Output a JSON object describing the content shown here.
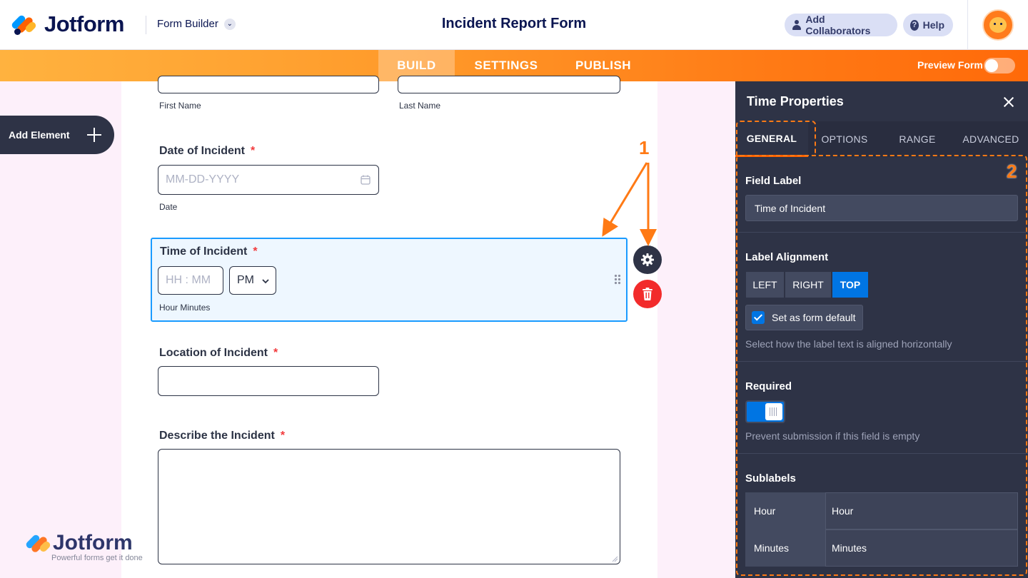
{
  "header": {
    "brand": "Jotform",
    "builder_label": "Form Builder",
    "form_title": "Incident Report Form",
    "collaborators_label": "Add Collaborators",
    "help_label": "Help"
  },
  "nav": {
    "tabs": [
      "BUILD",
      "SETTINGS",
      "PUBLISH"
    ],
    "active": "BUILD",
    "preview_label": "Preview Form"
  },
  "sidebar": {
    "add_element_label": "Add Element"
  },
  "form": {
    "name_sublabels": [
      "First Name",
      "Last Name"
    ],
    "fields": [
      {
        "label": "Date of Incident",
        "required": "*",
        "placeholder": "MM-DD-YYYY",
        "sublabel": "Date"
      },
      {
        "label": "Time of Incident",
        "required": "*",
        "placeholder": "HH : MM",
        "ampm": "PM",
        "sublabel": "Hour Minutes"
      },
      {
        "label": "Location of Incident",
        "required": "*"
      },
      {
        "label": "Describe the Incident",
        "required": "*"
      }
    ],
    "watermark_brand": "Jotform",
    "watermark_tagline": "Powerful forms get it done"
  },
  "panel": {
    "title": "Time Properties",
    "tabs": [
      "GENERAL",
      "OPTIONS",
      "RANGE",
      "ADVANCED"
    ],
    "active_tab": "GENERAL",
    "field_label_heading": "Field Label",
    "field_label_value": "Time of Incident",
    "label_alignment_heading": "Label Alignment",
    "alignment_options": [
      "LEFT",
      "RIGHT",
      "TOP"
    ],
    "alignment_selected": "TOP",
    "set_default_label": "Set as form default",
    "alignment_hint": "Select how the label text is aligned horizontally",
    "required_heading": "Required",
    "required_on": true,
    "required_hint": "Prevent submission if this field is empty",
    "sublabels_heading": "Sublabels",
    "sublabels": [
      {
        "name": "Hour",
        "value": "Hour"
      },
      {
        "name": "Minutes",
        "value": "Minutes"
      }
    ]
  },
  "annotations": [
    "1",
    "2"
  ],
  "colors": {
    "brand_orange": "#ff6100",
    "panel_bg": "#2e3346",
    "accent_blue": "#0075e3",
    "selected_border": "#1a9bff",
    "annotation": "#ff7a15"
  }
}
